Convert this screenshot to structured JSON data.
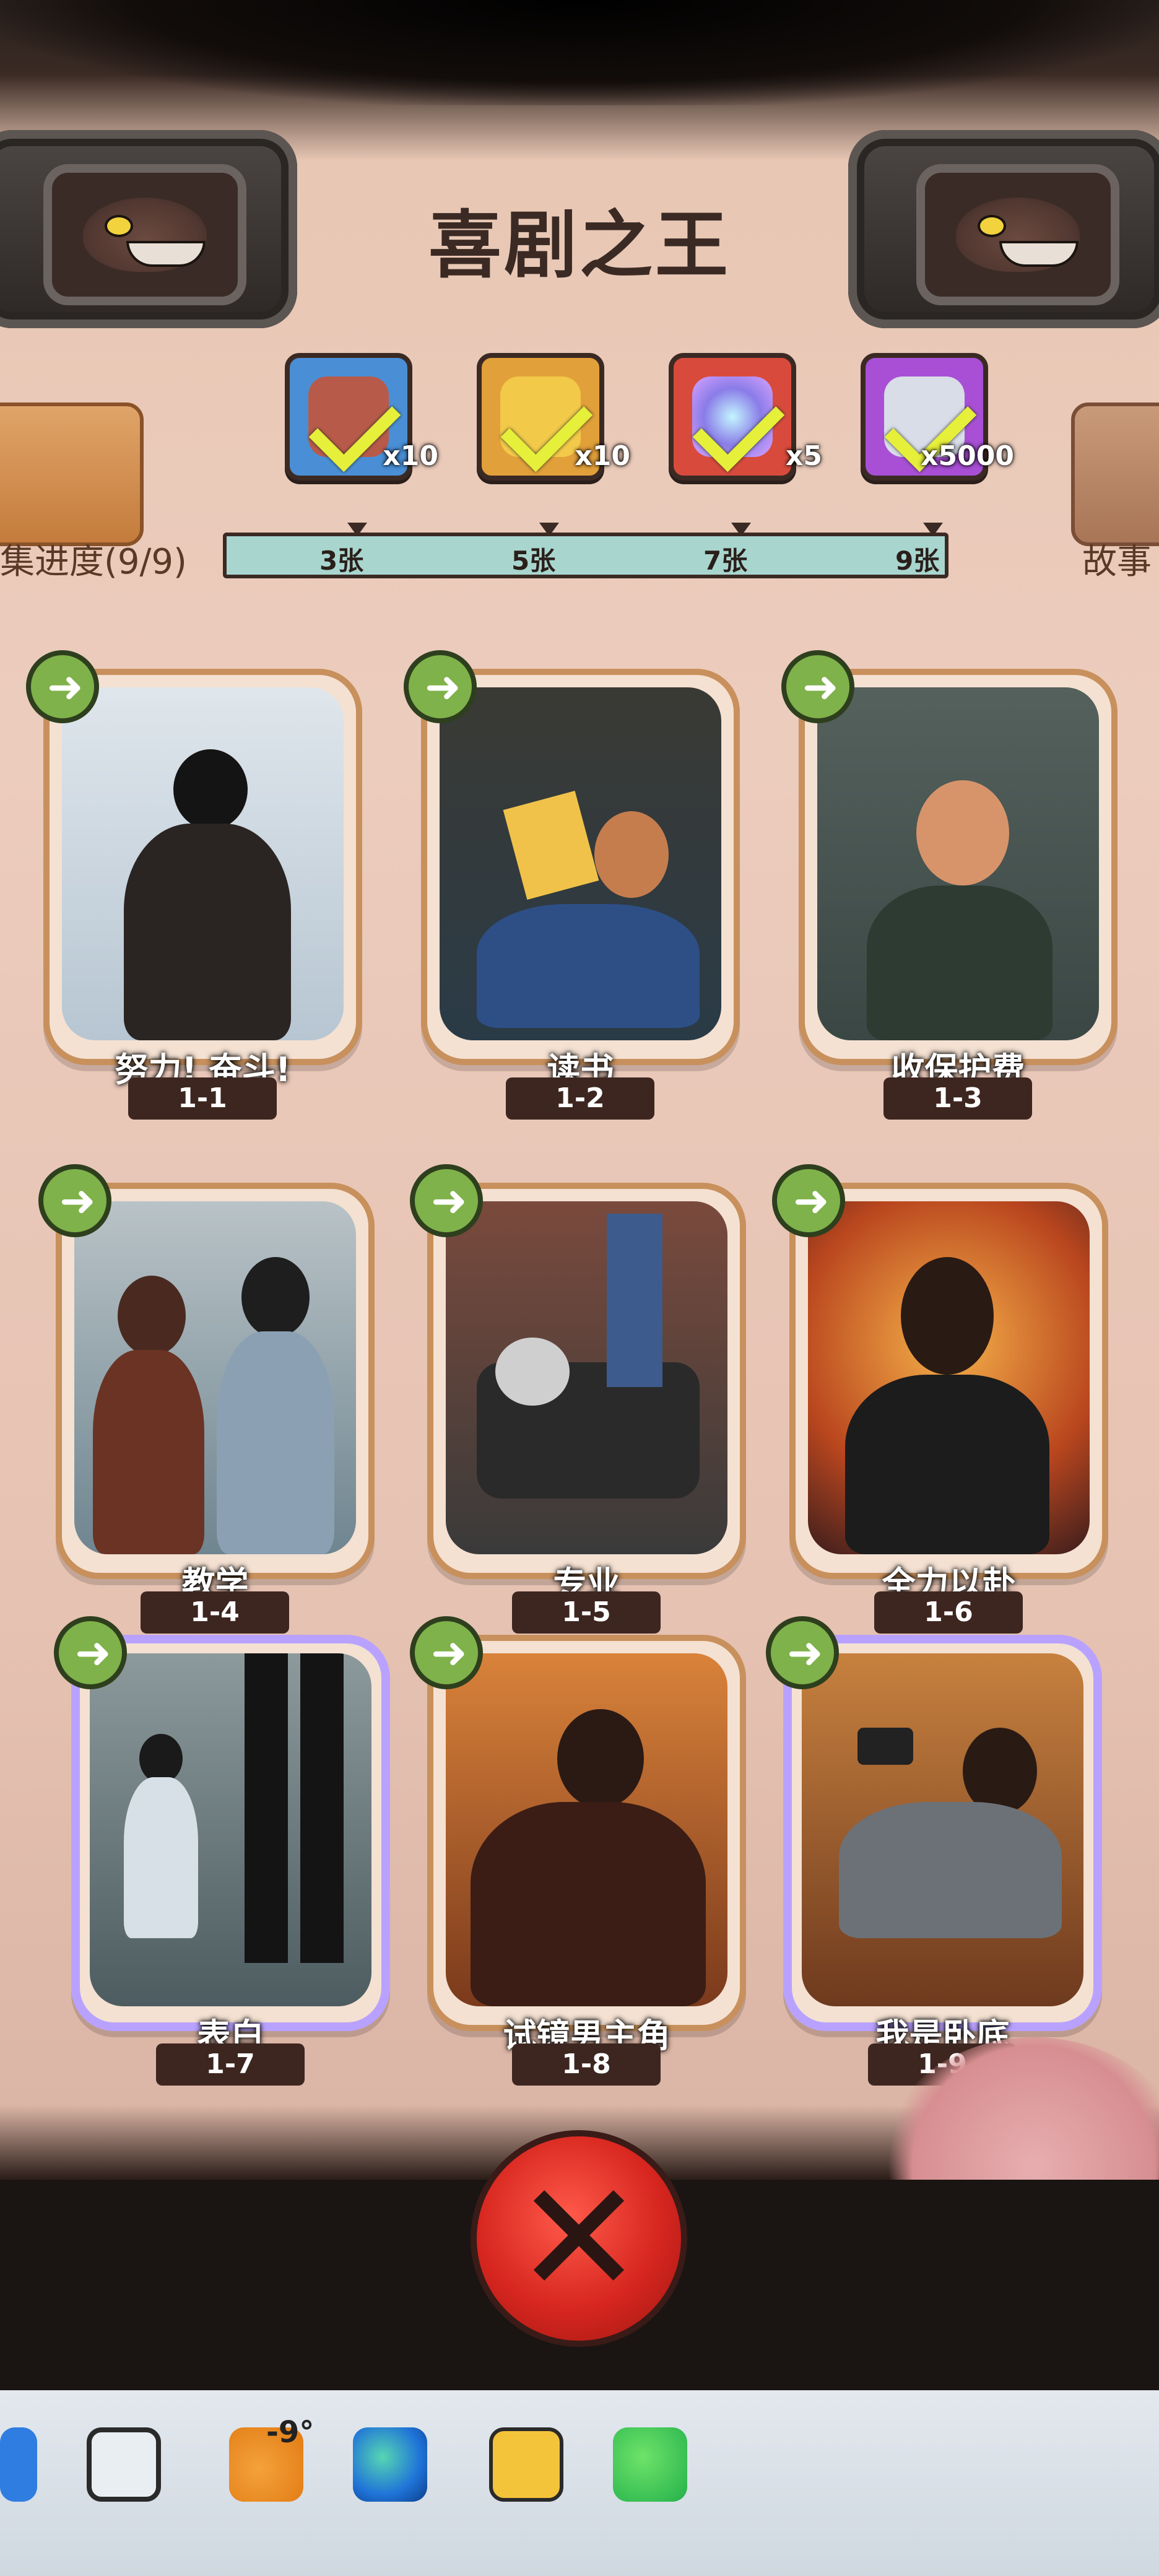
{
  "title": "喜剧之王",
  "side_left_label": "集进度(9/9)",
  "side_right_label": "故事",
  "rewards": [
    {
      "icon": "meat-icon",
      "count": "x10"
    },
    {
      "icon": "key-icon",
      "count": "x10"
    },
    {
      "icon": "orb-icon",
      "count": "x5"
    },
    {
      "icon": "gem-icon",
      "count": "x5000"
    }
  ],
  "progress_labels": [
    "3张",
    "5张",
    "7张",
    "9张"
  ],
  "cards": [
    {
      "caption": "努力! 奋斗!",
      "num": "1-1"
    },
    {
      "caption": "读书",
      "num": "1-2"
    },
    {
      "caption": "收保护费",
      "num": "1-3"
    },
    {
      "caption": "教学",
      "num": "1-4"
    },
    {
      "caption": "专业",
      "num": "1-5"
    },
    {
      "caption": "全力以赴",
      "num": "1-6"
    },
    {
      "caption": "表白",
      "num": "1-7"
    },
    {
      "caption": "试镜男主角",
      "num": "1-8"
    },
    {
      "caption": "我是卧底",
      "num": "1-9"
    }
  ],
  "taskbar": {
    "weather": "-9°"
  },
  "colors": {
    "card_border": "#c8905c",
    "progress_bar": "#a8d6cf",
    "share_button": "#7fb24a",
    "close_button": "#d7261f"
  }
}
